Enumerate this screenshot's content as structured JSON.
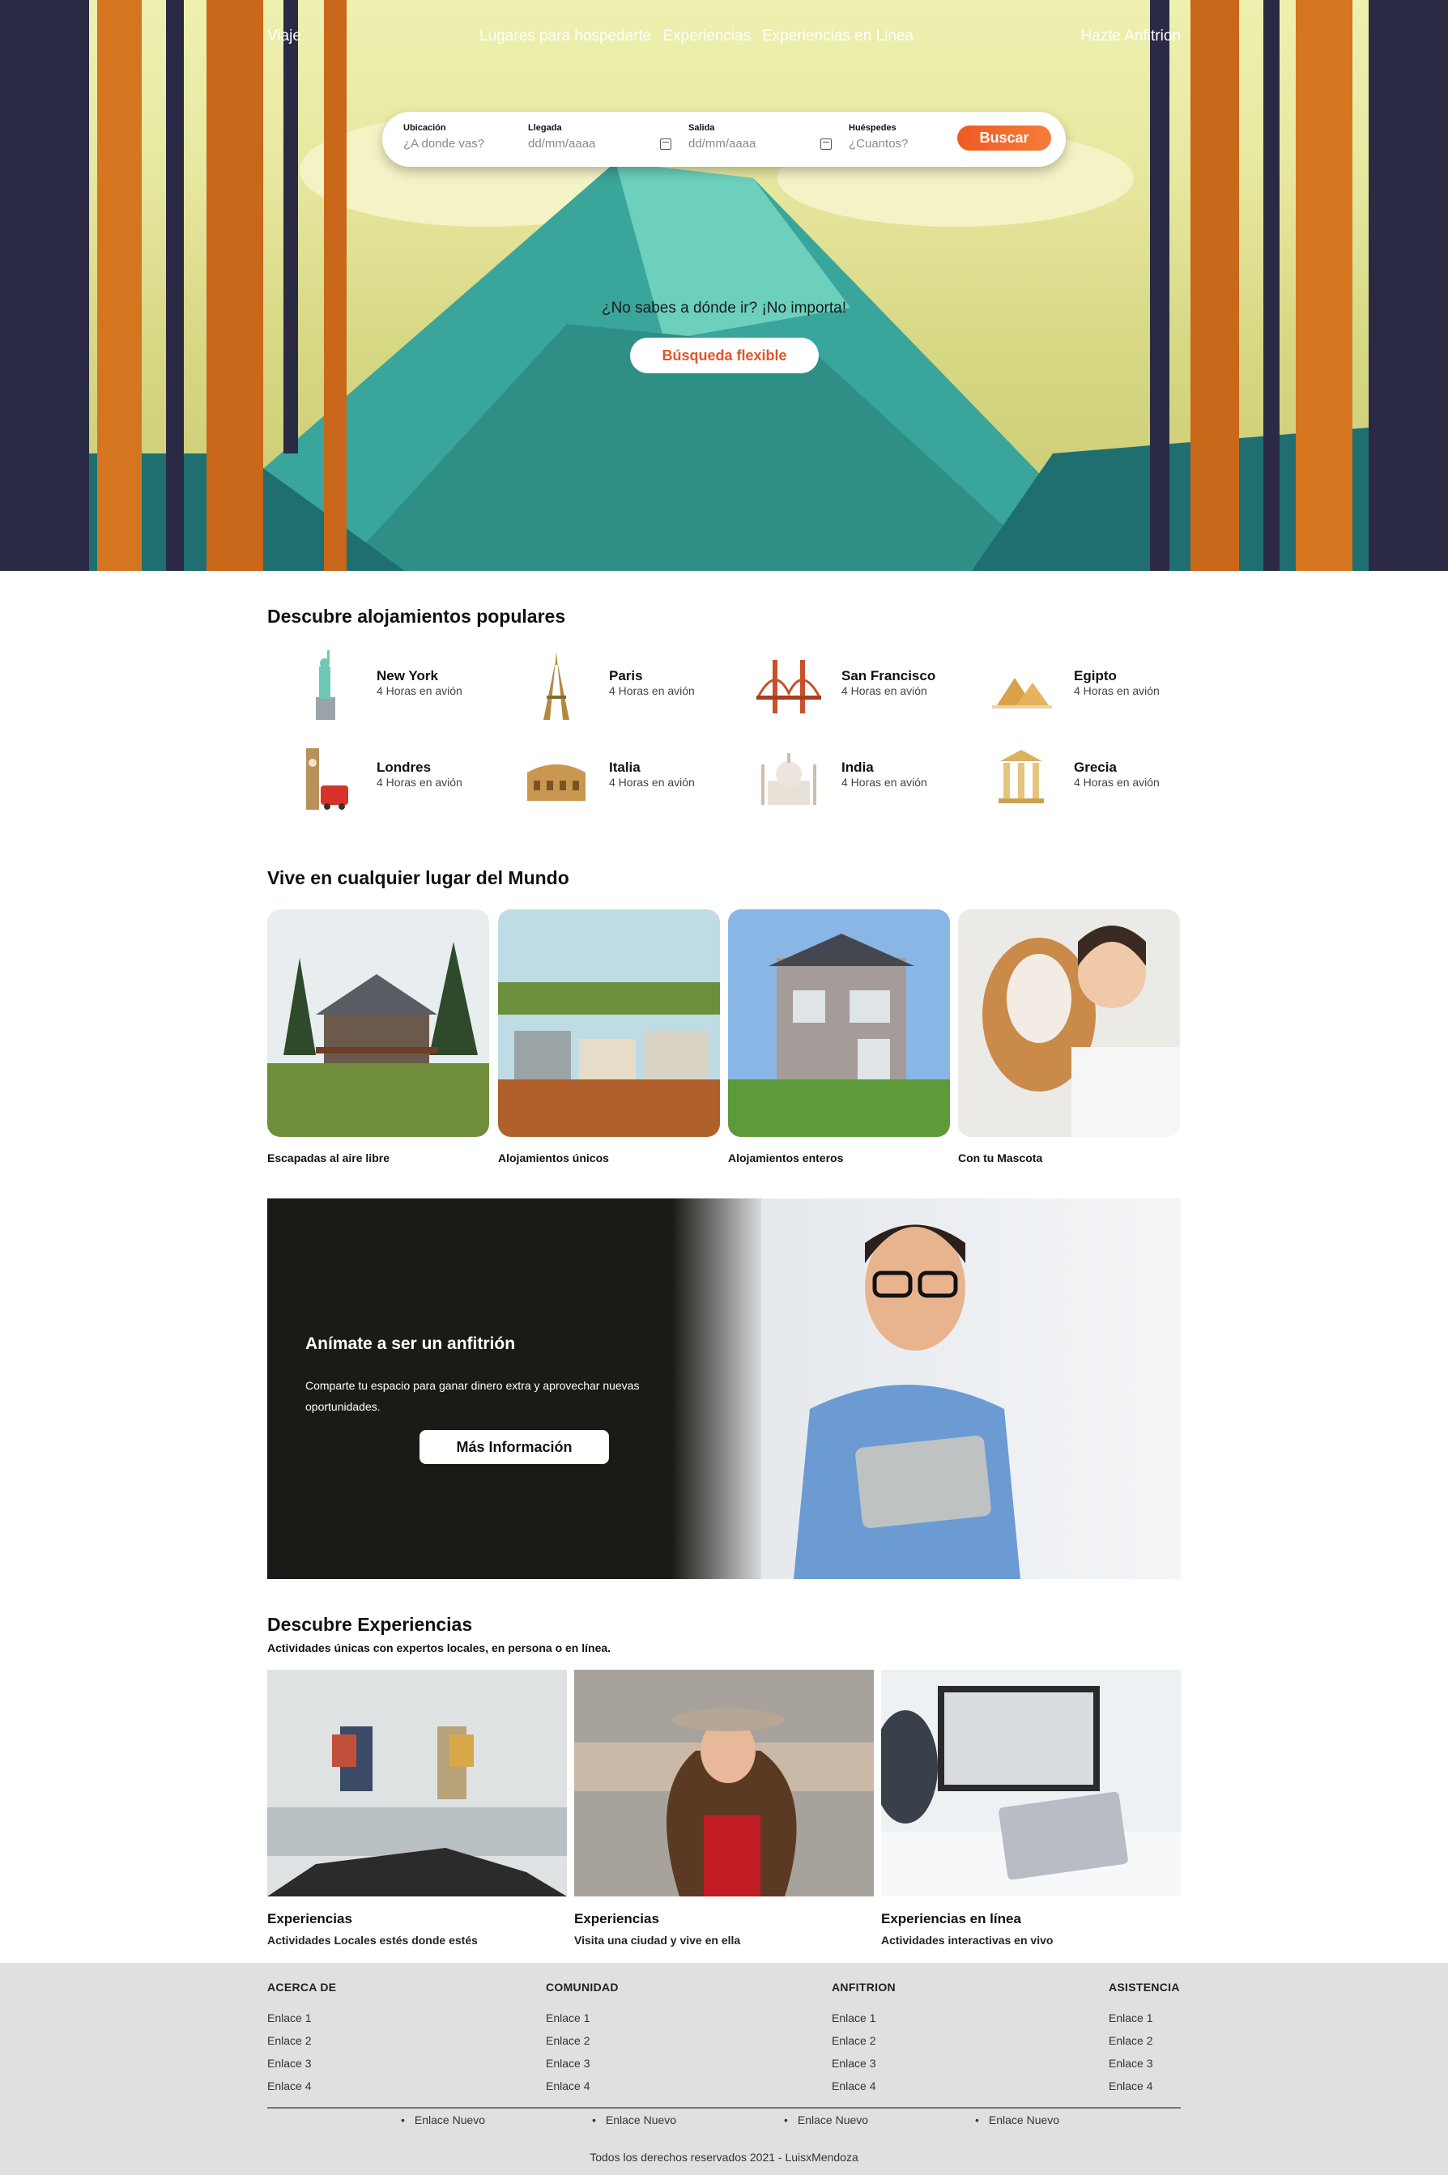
{
  "nav": {
    "brand": "Viaje",
    "links": [
      "Lugares para hospedarte",
      "Experiencias",
      "Experiencias en Linea"
    ],
    "host": "Hazte Anfitrion"
  },
  "search": {
    "location_label": "Ubicación",
    "location_placeholder": "¿A donde vas?",
    "checkin_label": "Llegada",
    "checkin_value": "dd/mm/aaaa",
    "checkout_label": "Salida",
    "checkout_value": "dd/mm/aaaa",
    "guests_label": "Huéspedes",
    "guests_placeholder": "¿Cuantos?",
    "button": "Buscar"
  },
  "flexible": {
    "question": "¿No sabes a dónde ir? ¡No importa!",
    "button": "Búsqueda flexible"
  },
  "popular": {
    "title": "Descubre alojamientos populares",
    "items": [
      {
        "name": "New York",
        "sub": "4 Horas en avión",
        "icon": "statue-of-liberty-icon"
      },
      {
        "name": "Paris",
        "sub": "4 Horas en avión",
        "icon": "eiffel-tower-icon"
      },
      {
        "name": "San Francisco",
        "sub": "4 Horas en avión",
        "icon": "golden-gate-icon"
      },
      {
        "name": "Egipto",
        "sub": "4 Horas en avión",
        "icon": "pyramids-icon"
      },
      {
        "name": "Londres",
        "sub": "4 Horas en avión",
        "icon": "big-ben-icon"
      },
      {
        "name": "Italia",
        "sub": "4 Horas en avión",
        "icon": "colosseum-icon"
      },
      {
        "name": "India",
        "sub": "4 Horas en avión",
        "icon": "taj-mahal-icon"
      },
      {
        "name": "Grecia",
        "sub": "4 Horas en avión",
        "icon": "greek-temple-icon"
      }
    ]
  },
  "anywhere": {
    "title": "Vive en cualquier lugar del Mundo",
    "cards": [
      {
        "caption": "Escapadas al aire libre"
      },
      {
        "caption": "Alojamientos únicos"
      },
      {
        "caption": "Alojamientos enteros"
      },
      {
        "caption": "Con tu Mascota"
      }
    ]
  },
  "host_banner": {
    "title": "Anímate a ser un anfitrión",
    "text": "Comparte tu espacio para ganar dinero extra y aprovechar nuevas oportunidades.",
    "button": "Más Información"
  },
  "experiences": {
    "title": "Descubre Experiencias",
    "subtitle": "Actividades únicas con expertos locales, en persona o en línea.",
    "items": [
      {
        "title": "Experiencias",
        "sub": "Actividades Locales estés donde estés"
      },
      {
        "title": "Experiencias",
        "sub": "Visita una ciudad y vive en ella"
      },
      {
        "title": "Experiencias en línea",
        "sub": "Actividades interactivas en vivo"
      }
    ]
  },
  "footer": {
    "columns": [
      {
        "title": "ACERCA DE",
        "links": [
          "Enlace 1",
          "Enlace 2",
          "Enlace 3",
          "Enlace 4"
        ]
      },
      {
        "title": "COMUNIDAD",
        "links": [
          "Enlace 1",
          "Enlace 2",
          "Enlace 3",
          "Enlace 4"
        ]
      },
      {
        "title": "ANFITRION",
        "links": [
          "Enlace 1",
          "Enlace 2",
          "Enlace 3",
          "Enlace 4"
        ]
      },
      {
        "title": "ASISTENCIA",
        "links": [
          "Enlace 1",
          "Enlace 2",
          "Enlace 3",
          "Enlace 4"
        ]
      }
    ],
    "new_links": [
      "Enlace Nuevo",
      "Enlace Nuevo",
      "Enlace Nuevo",
      "Enlace Nuevo"
    ],
    "copyright": "Todos los derechos reservados 2021 - LuisxMendoza"
  },
  "colors": {
    "accent": "#f05a23",
    "dark_banner": "#1b1a16",
    "footer_bg": "#e0e0e0"
  }
}
